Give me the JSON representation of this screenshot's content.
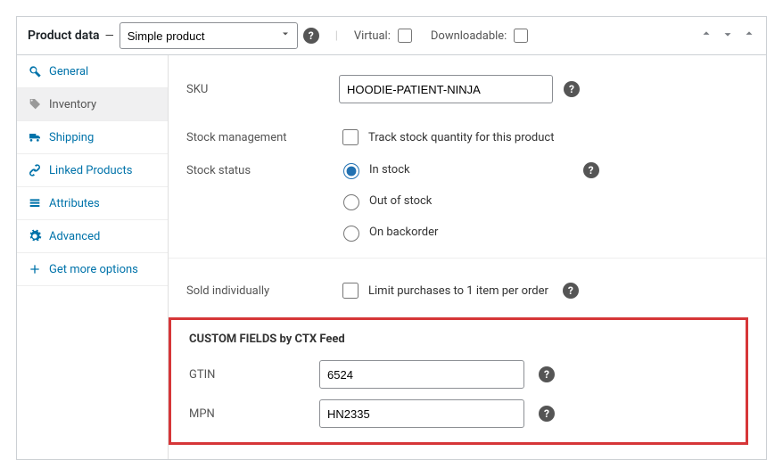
{
  "header": {
    "title": "Product data",
    "product_type": "Simple product",
    "virtual_label": "Virtual:",
    "downloadable_label": "Downloadable:"
  },
  "tabs": {
    "general": "General",
    "inventory": "Inventory",
    "shipping": "Shipping",
    "linked": "Linked Products",
    "attributes": "Attributes",
    "advanced": "Advanced",
    "more": "Get more options"
  },
  "inventory": {
    "sku_label": "SKU",
    "sku_value": "HOODIE-PATIENT-NINJA",
    "stock_mgmt_label": "Stock management",
    "stock_mgmt_check": "Track stock quantity for this product",
    "stock_status_label": "Stock status",
    "status_in": "In stock",
    "status_out": "Out of stock",
    "status_back": "On backorder",
    "sold_indiv_label": "Sold individually",
    "sold_indiv_check": "Limit purchases to 1 item per order"
  },
  "custom": {
    "heading": "CUSTOM FIELDS by CTX Feed",
    "gtin_label": "GTIN",
    "gtin_value": "6524",
    "mpn_label": "MPN",
    "mpn_value": "HN2335"
  }
}
